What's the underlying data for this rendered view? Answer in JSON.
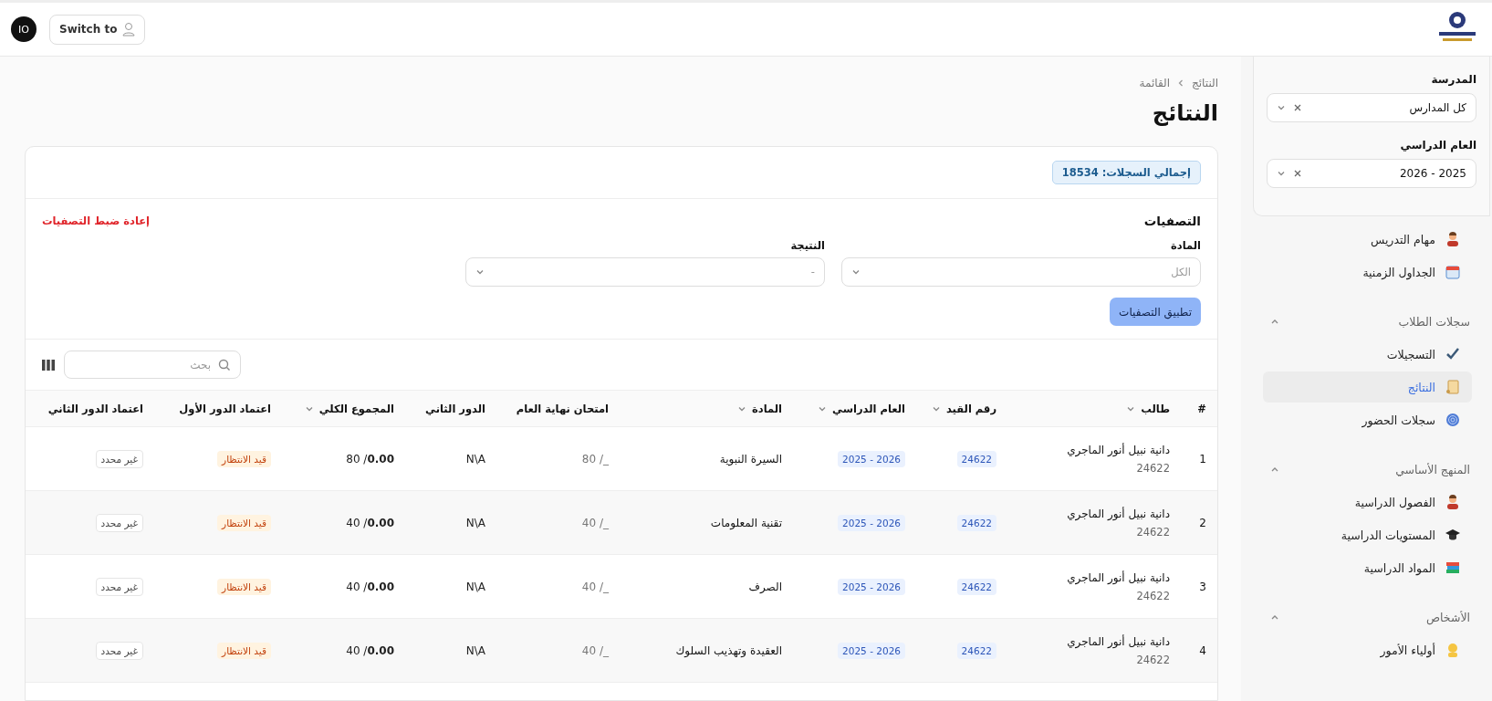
{
  "topbar": {
    "avatar": "IO",
    "switch_button": "Switch to"
  },
  "sidebar": {
    "school_label": "المدرسة",
    "school_value": "كل المدارس",
    "year_label": "العام الدراسي",
    "year_value": "2025 - 2026",
    "items": [
      {
        "kind": "item",
        "label": "مهام التدريس",
        "selected": false
      },
      {
        "kind": "item",
        "label": "الجداول الزمنية",
        "selected": false
      },
      {
        "kind": "section",
        "label": "سجلات الطلاب",
        "expanded": true
      },
      {
        "kind": "item",
        "label": "التسجيلات",
        "selected": false
      },
      {
        "kind": "item",
        "label": "النتائج",
        "selected": true
      },
      {
        "kind": "item",
        "label": "سجلات الحضور",
        "selected": false
      },
      {
        "kind": "section",
        "label": "المنهج الأساسي",
        "expanded": true
      },
      {
        "kind": "item",
        "label": "الفصول الدراسية",
        "selected": false
      },
      {
        "kind": "item",
        "label": "المستويات الدراسية",
        "selected": false
      },
      {
        "kind": "item",
        "label": "المواد الدراسية",
        "selected": false
      },
      {
        "kind": "section",
        "label": "الأشخاص",
        "expanded": true
      },
      {
        "kind": "item",
        "label": "أولياء الأمور",
        "selected": false
      }
    ]
  },
  "breadcrumb": [
    "النتائج",
    "القائمة"
  ],
  "title": "النتائج",
  "total_badge": "إجمالي السجلات: 18534",
  "filters": {
    "title": "التصفيات",
    "reset": "إعادة ضبط التصفيات",
    "fields": [
      {
        "label": "المادة",
        "placeholder": "الكل"
      },
      {
        "label": "النتيجة",
        "placeholder": "-"
      }
    ],
    "apply": "تطبيق التصفيات"
  },
  "search": {
    "placeholder": "بحث"
  },
  "table": {
    "columns": [
      {
        "label": "#",
        "sortable": false
      },
      {
        "label": "طالب",
        "sortable": true
      },
      {
        "label": "رقم القيد",
        "sortable": true
      },
      {
        "label": "العام الدراسي",
        "sortable": true
      },
      {
        "label": "المادة",
        "sortable": true
      },
      {
        "label": "امتحان نهاية العام",
        "sortable": false
      },
      {
        "label": "الدور الثاني",
        "sortable": false
      },
      {
        "label": "المجموع الكلي",
        "sortable": true
      },
      {
        "label": "اعتماد الدور الأول",
        "sortable": false
      },
      {
        "label": "اعتماد الدور الثاني",
        "sortable": false
      }
    ],
    "rows": [
      {
        "num": "1",
        "name": "دانية نبيل أنور الماجري",
        "student_id": "24622",
        "reg": "24622",
        "year": "2026 - 2025",
        "subject": "السيرة النبوية",
        "exam": "80 /_",
        "second": "N\\A",
        "total": "80 /**0.00**",
        "approval1": {
          "kind": "pending",
          "label": "قيد الانتظار"
        },
        "approval2": {
          "kind": "unset",
          "label": "غير محدد"
        }
      },
      {
        "num": "2",
        "name": "دانية نبيل أنور الماجري",
        "student_id": "24622",
        "reg": "24622",
        "year": "2026 - 2025",
        "subject": "تقنية المعلومات",
        "exam": "40 /_",
        "second": "N\\A",
        "total": "40 /**0.00**",
        "approval1": {
          "kind": "pending",
          "label": "قيد الانتظار"
        },
        "approval2": {
          "kind": "unset",
          "label": "غير محدد"
        }
      },
      {
        "num": "3",
        "name": "دانية نبيل أنور الماجري",
        "student_id": "24622",
        "reg": "24622",
        "year": "2026 - 2025",
        "subject": "الصرف",
        "exam": "40 /_",
        "second": "N\\A",
        "total": "40 /**0.00**",
        "approval1": {
          "kind": "pending",
          "label": "قيد الانتظار"
        },
        "approval2": {
          "kind": "unset",
          "label": "غير محدد"
        }
      },
      {
        "num": "4",
        "name": "دانية نبيل أنور الماجري",
        "student_id": "24622",
        "reg": "24622",
        "year": "2026 - 2025",
        "subject": "العقيدة وتهذيب السلوك",
        "exam": "40 /_",
        "second": "N\\A",
        "total": "40 /**0.00**",
        "approval1": {
          "kind": "pending",
          "label": "قيد الانتظار"
        },
        "approval2": {
          "kind": "unset",
          "label": "غير محدد"
        }
      }
    ]
  }
}
